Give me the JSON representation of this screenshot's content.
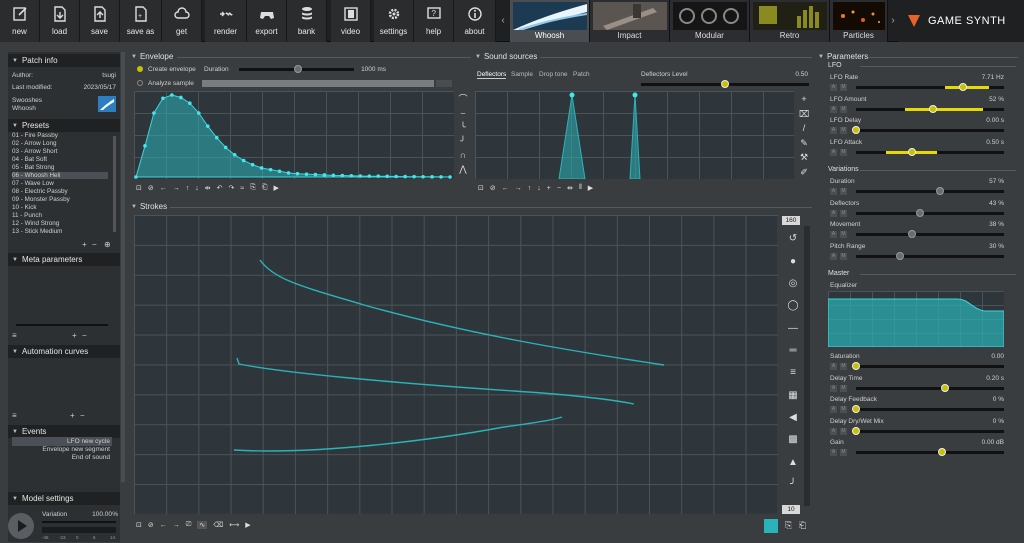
{
  "toolbar": {
    "buttons": [
      "new",
      "load",
      "save",
      "save as",
      "get",
      "render",
      "export",
      "bank",
      "video",
      "settings",
      "help",
      "about"
    ]
  },
  "modules": [
    "Whoosh",
    "Impact",
    "Modular",
    "Retro",
    "Particles"
  ],
  "logo": "GAME SYNTH",
  "patch_info": {
    "title": "Patch info",
    "author_label": "Author:",
    "author": "tsugi",
    "modified_label": "Last modified:",
    "modified": "2023/05/17",
    "tags": [
      "Swooshes",
      "Whoosh"
    ]
  },
  "presets": {
    "title": "Presets",
    "items": [
      "01 - Fire Passby",
      "02 - Arrow Long",
      "03 - Arrow Short",
      "04 - Bat Soft",
      "05 - Bat Strong",
      "06 - Whoosh Heli",
      "07 - Wave Low",
      "08 - Electric Passby",
      "09 - Monster Passby",
      "10 - Kick",
      "11 - Punch",
      "12 - Wind Strong",
      "13 - Stick Medium"
    ]
  },
  "meta": {
    "title": "Meta parameters"
  },
  "automation": {
    "title": "Automation curves"
  },
  "events": {
    "title": "Events",
    "items": [
      "LFO new cycle",
      "Envelope new segment",
      "End of sound"
    ]
  },
  "model": {
    "title": "Model settings",
    "variation_label": "Variation",
    "variation": "100.00",
    "variation_unit": "%",
    "scale": [
      "-46",
      "-23",
      "0",
      "6",
      "14"
    ]
  },
  "envelope": {
    "title": "Envelope",
    "create": "Create envelope",
    "duration_label": "Duration",
    "duration": "1000 ms",
    "analyze": "Analyze sample",
    "points": [
      0,
      0.38,
      0.78,
      0.96,
      1.0,
      0.97,
      0.9,
      0.78,
      0.62,
      0.48,
      0.36,
      0.27,
      0.2,
      0.15,
      0.11,
      0.09,
      0.07,
      0.05,
      0.04,
      0.035,
      0.03,
      0.025,
      0.02,
      0.018,
      0.015,
      0.012,
      0.01,
      0.01,
      0.008,
      0.006,
      0.005,
      0.004,
      0.003,
      0.002,
      0.001,
      0
    ]
  },
  "sound_sources": {
    "title": "Sound sources",
    "tabs": [
      "Deflectors",
      "Sample",
      "Drop tone",
      "Patch"
    ],
    "level_label": "Deflectors Level",
    "level": "0.50",
    "level_value": 0.5
  },
  "strokes": {
    "title": "Strokes",
    "zoom": "160",
    "count": "10"
  },
  "parameters": {
    "title": "Parameters",
    "lfo": {
      "title": "LFO",
      "items": [
        {
          "label": "LFO Rate",
          "value": "7.71 Hz",
          "pos": 0.72,
          "band": [
            0.6,
            0.9
          ]
        },
        {
          "label": "LFO Amount",
          "value": "52 %",
          "pos": 0.52,
          "band": [
            0.33,
            0.86
          ]
        },
        {
          "label": "LFO Delay",
          "value": "0.00 s",
          "pos": 0.0
        },
        {
          "label": "LFO Attack",
          "value": "0.50 s",
          "pos": 0.38,
          "band": [
            0.2,
            0.55
          ]
        }
      ]
    },
    "variations": {
      "title": "Variations",
      "items": [
        {
          "label": "Duration",
          "value": "57 %",
          "pos": 0.57
        },
        {
          "label": "Deflectors",
          "value": "43 %",
          "pos": 0.43
        },
        {
          "label": "Movement",
          "value": "38 %",
          "pos": 0.38
        },
        {
          "label": "Pitch Range",
          "value": "30 %",
          "pos": 0.3
        }
      ]
    },
    "master": {
      "title": "Master",
      "equalizer": "Equalizer",
      "items": [
        {
          "label": "Saturation",
          "value": "0.00",
          "pos": 0.0
        },
        {
          "label": "Delay Time",
          "value": "0.20 s",
          "pos": 0.6
        },
        {
          "label": "Delay Feedback",
          "value": "0 %",
          "pos": 0.0
        },
        {
          "label": "Delay Dry/Wet Mix",
          "value": "0 %",
          "pos": 0.0
        },
        {
          "label": "Gain",
          "value": "0.00 dB",
          "pos": 0.58
        }
      ]
    }
  },
  "colors": {
    "accent": "#2ab3b8",
    "yellow": "#e6da00"
  }
}
